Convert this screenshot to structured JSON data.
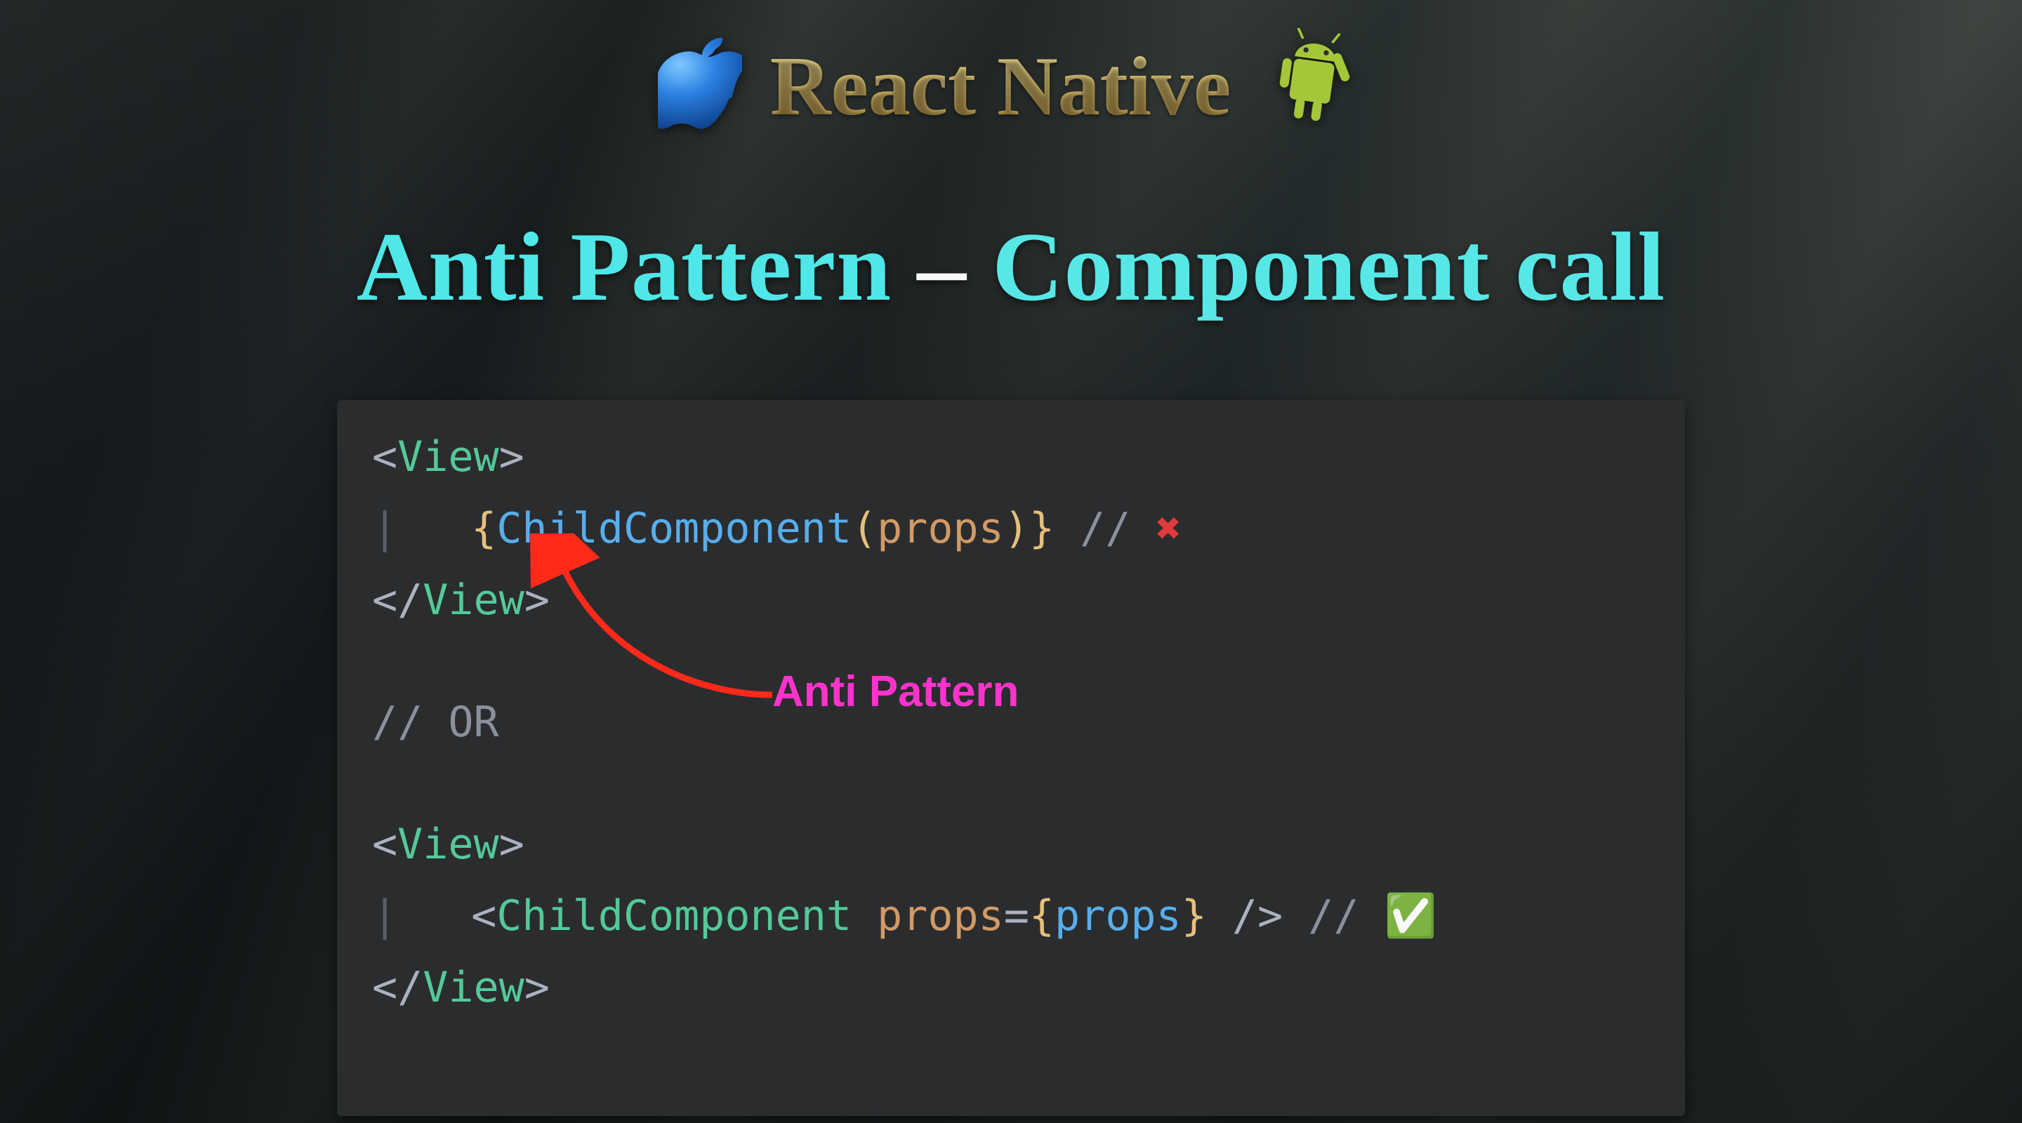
{
  "header": {
    "title": "React Native",
    "apple_icon": "apple-icon",
    "android_icon": "android-icon"
  },
  "subtitle": {
    "part_a": "Anti Pattern",
    "sep": " – ",
    "part_b": "Component call"
  },
  "annotation": {
    "label": "Anti Pattern"
  },
  "code": {
    "l1_open": "<",
    "l1_tag": "View",
    "l1_close": ">",
    "l2_guide": "|",
    "l2_lbrace": "{",
    "l2_func": "ChildComponent",
    "l2_lparen": "(",
    "l2_arg": "props",
    "l2_rparen": ")",
    "l2_rbrace": "}",
    "l2_comment": " // ",
    "l2_mark": "✖",
    "l3_open": "</",
    "l3_tag": "View",
    "l3_close": ">",
    "or_line": "// OR",
    "l5_open": "<",
    "l5_tag": "View",
    "l5_close": ">",
    "l6_guide": "|",
    "l6_lt": "<",
    "l6_tag": "ChildComponent",
    "l6_space": " ",
    "l6_attr": "props",
    "l6_eq": "=",
    "l6_lbrace": "{",
    "l6_val": "props",
    "l6_rbrace": "}",
    "l6_selfclose": " />",
    "l6_comment": " // ",
    "l6_mark": "✅",
    "l7_open": "</",
    "l7_tag": "View",
    "l7_close": ">"
  }
}
